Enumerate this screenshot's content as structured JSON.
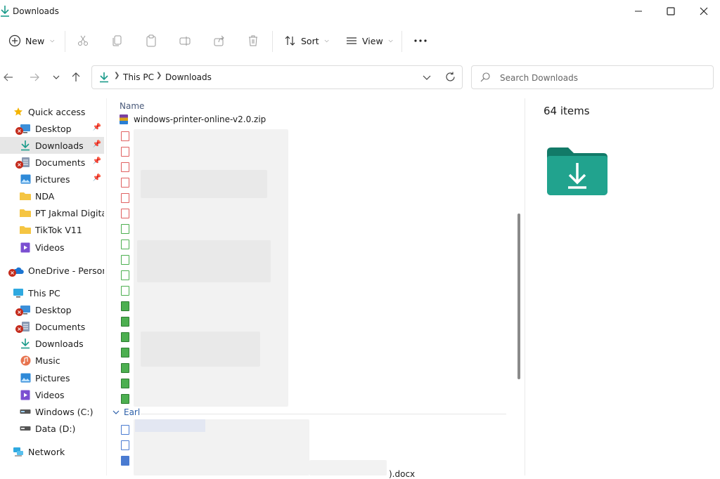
{
  "window": {
    "title": "Downloads",
    "controls": [
      "minimize-icon",
      "maximize-icon",
      "close-icon"
    ]
  },
  "toolbar": {
    "new_label": "New",
    "sort_label": "Sort",
    "view_label": "View",
    "icons": [
      "cut-icon",
      "copy-icon",
      "paste-icon",
      "rename-icon",
      "share-icon",
      "delete-icon",
      "more-icon"
    ]
  },
  "address": {
    "crumbs": [
      "This PC",
      "Downloads"
    ]
  },
  "search": {
    "placeholder": "Search Downloads"
  },
  "sidebar": {
    "quick_access": "Quick access",
    "quick_items": [
      {
        "label": "Desktop",
        "icon": "desktop-icon",
        "pinned": true,
        "error": true
      },
      {
        "label": "Downloads",
        "icon": "download-icon",
        "pinned": true,
        "error": false,
        "active": true
      },
      {
        "label": "Documents",
        "icon": "documents-icon",
        "pinned": true,
        "error": true
      },
      {
        "label": "Pictures",
        "icon": "pictures-icon",
        "pinned": true,
        "error": false
      },
      {
        "label": "NDA",
        "icon": "folder-icon",
        "pinned": false,
        "error": false
      },
      {
        "label": "PT Jakmal Digital N",
        "icon": "folder-icon",
        "pinned": false,
        "error": false
      },
      {
        "label": "TikTok V11",
        "icon": "folder-icon",
        "pinned": false,
        "error": false
      },
      {
        "label": "Videos",
        "icon": "videos-icon",
        "pinned": false,
        "error": false
      }
    ],
    "onedrive": "OneDrive - Personal",
    "this_pc": "This PC",
    "pc_items": [
      {
        "label": "Desktop",
        "icon": "desktop-icon",
        "error": true
      },
      {
        "label": "Documents",
        "icon": "documents-icon",
        "error": true
      },
      {
        "label": "Downloads",
        "icon": "download-icon",
        "error": false
      },
      {
        "label": "Music",
        "icon": "music-icon",
        "error": false
      },
      {
        "label": "Pictures",
        "icon": "pictures-icon",
        "error": false
      },
      {
        "label": "Videos",
        "icon": "videos-icon",
        "error": false
      },
      {
        "label": "Windows (C:)",
        "icon": "drive-icon",
        "error": false
      },
      {
        "label": "Data (D:)",
        "icon": "drive-icon",
        "error": false
      }
    ],
    "network": "Network"
  },
  "list": {
    "column_name": "Name",
    "first_file": "windows-printer-online-v2.0.zip",
    "group_earlier": "Earl",
    "partial_text": ").docx"
  },
  "details": {
    "count": "64 items"
  },
  "colors": {
    "accent": "#1a9b8a",
    "folder": "#21a38e",
    "error": "#c42b1c"
  }
}
